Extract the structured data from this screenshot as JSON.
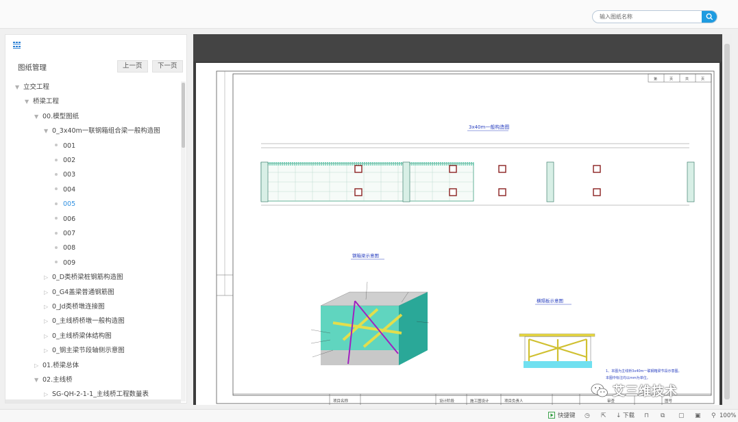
{
  "search": {
    "placeholder": "输入图纸名称"
  },
  "panel": {
    "title": "图纸管理",
    "prev_label": "上一页",
    "next_label": "下一页"
  },
  "tree": [
    {
      "label": "立交工程",
      "level": 0,
      "expanded": true,
      "type": "folder"
    },
    {
      "label": "桥梁工程",
      "level": 1,
      "expanded": true,
      "type": "folder"
    },
    {
      "label": "00.模型图纸",
      "level": 2,
      "expanded": true,
      "type": "folder"
    },
    {
      "label": "0_3x40m一联钢箱组合梁一般构造图",
      "level": 3,
      "expanded": true,
      "type": "folder"
    },
    {
      "label": "001",
      "level": 4,
      "type": "leaf"
    },
    {
      "label": "002",
      "level": 4,
      "type": "leaf"
    },
    {
      "label": "003",
      "level": 4,
      "type": "leaf"
    },
    {
      "label": "004",
      "level": 4,
      "type": "leaf"
    },
    {
      "label": "005",
      "level": 4,
      "type": "leaf",
      "active": true
    },
    {
      "label": "006",
      "level": 4,
      "type": "leaf"
    },
    {
      "label": "007",
      "level": 4,
      "type": "leaf"
    },
    {
      "label": "008",
      "level": 4,
      "type": "leaf"
    },
    {
      "label": "009",
      "level": 4,
      "type": "leaf"
    },
    {
      "label": "0_D类桥梁桩钢筋构造图",
      "level": 3,
      "expanded": false,
      "type": "folder"
    },
    {
      "label": "0_G4盖梁普通钢筋图",
      "level": 3,
      "expanded": false,
      "type": "folder"
    },
    {
      "label": "0_Jd类桥墩连接图",
      "level": 3,
      "expanded": false,
      "type": "folder"
    },
    {
      "label": "0_主线桥桥墩一般构造图",
      "level": 3,
      "expanded": false,
      "type": "folder"
    },
    {
      "label": "0_主线桥梁体结构图",
      "level": 3,
      "expanded": false,
      "type": "folder"
    },
    {
      "label": "0_钢主梁节段轴侧示意图",
      "level": 3,
      "expanded": false,
      "type": "folder"
    },
    {
      "label": "01.桥梁总体",
      "level": 2,
      "expanded": false,
      "type": "folder"
    },
    {
      "label": "02.主线桥",
      "level": 2,
      "expanded": true,
      "type": "folder"
    },
    {
      "label": "SG-QH-2-1-1_主线桥工程数量表",
      "level": 3,
      "expanded": false,
      "type": "folder"
    }
  ],
  "drawing": {
    "main_title": "3x40m一般构造图",
    "sub_title_left": "钢箱梁示意图",
    "sub_title_right": "横隔板示意图",
    "page_marks": [
      "第",
      "页",
      "共",
      "页"
    ],
    "notes": [
      "1、本图为主线桥3x40m一联钢箱梁节段示意图。",
      "本图中标注均以mm为单位。"
    ],
    "title_block": [
      "项目名称",
      "设计阶段",
      "施工图设计",
      "项目负责人",
      "审查",
      "图号"
    ]
  },
  "statusbar": {
    "fast_label": "快捷键",
    "download_label": "下载",
    "zoom_label": "100%"
  },
  "watermark": {
    "text": "艾三维技术"
  },
  "colors": {
    "accent": "#1e9be0",
    "active_tree": "#2f8fe0",
    "viewer_bg": "#3c3c3c",
    "drawing_blue": "#2a40c0",
    "drawing_green": "#40c0a0"
  }
}
